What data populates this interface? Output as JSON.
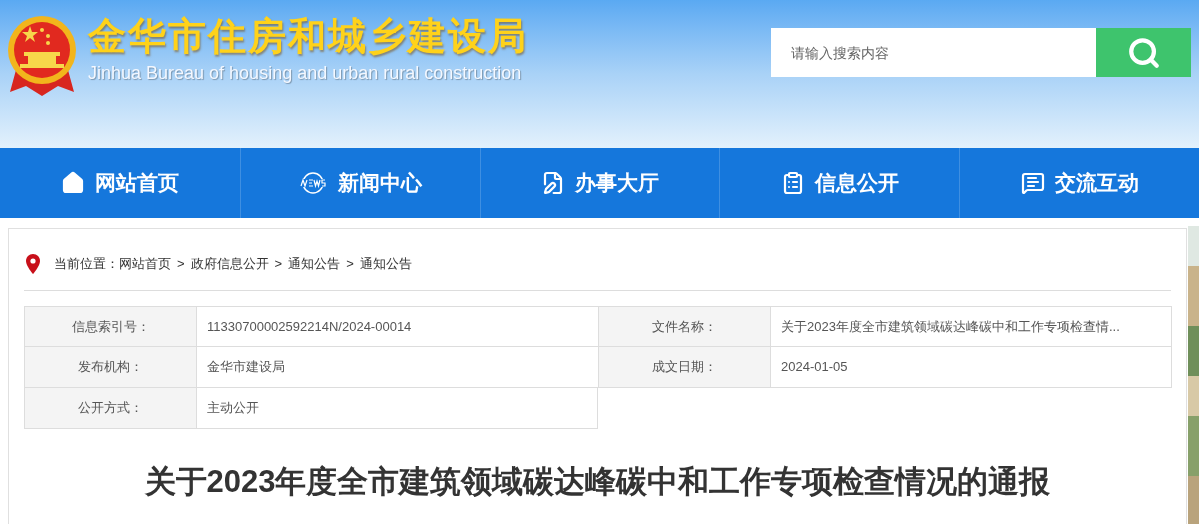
{
  "header": {
    "title": "金华市住房和城乡建设局",
    "subtitle": "Jinhua Bureau of housing and urban rural construction",
    "search": {
      "placeholder": "请输入搜索内容"
    }
  },
  "nav": [
    {
      "label": "网站首页",
      "kind": "home"
    },
    {
      "label": "新闻中心",
      "kind": "news"
    },
    {
      "label": "办事大厅",
      "kind": "edit"
    },
    {
      "label": "信息公开",
      "kind": "list"
    },
    {
      "label": "交流互动",
      "kind": "chat"
    }
  ],
  "breadcrumb": {
    "label": "当前位置：",
    "items": [
      {
        "text": "网站首页"
      },
      {
        "separator": ">",
        "text": "政府信息公开"
      },
      {
        "separator": ">",
        "text": "通知公告"
      },
      {
        "separator": ">",
        "text": "通知公告"
      }
    ]
  },
  "meta": [
    {
      "label": "信息索引号：",
      "value": "11330700002592214N/2024-00014"
    },
    {
      "label": "文件名称：",
      "value": "关于2023年度全市建筑领域碳达峰碳中和工作专项检查情..."
    },
    {
      "label": "发布机构：",
      "value": "金华市建设局"
    },
    {
      "label": "成文日期：",
      "value": "2024-01-05"
    },
    {
      "label": "公开方式：",
      "value": "主动公开"
    }
  ],
  "article": {
    "title": "关于2023年度全市建筑领域碳达峰碳中和工作专项检查情况的通报"
  }
}
